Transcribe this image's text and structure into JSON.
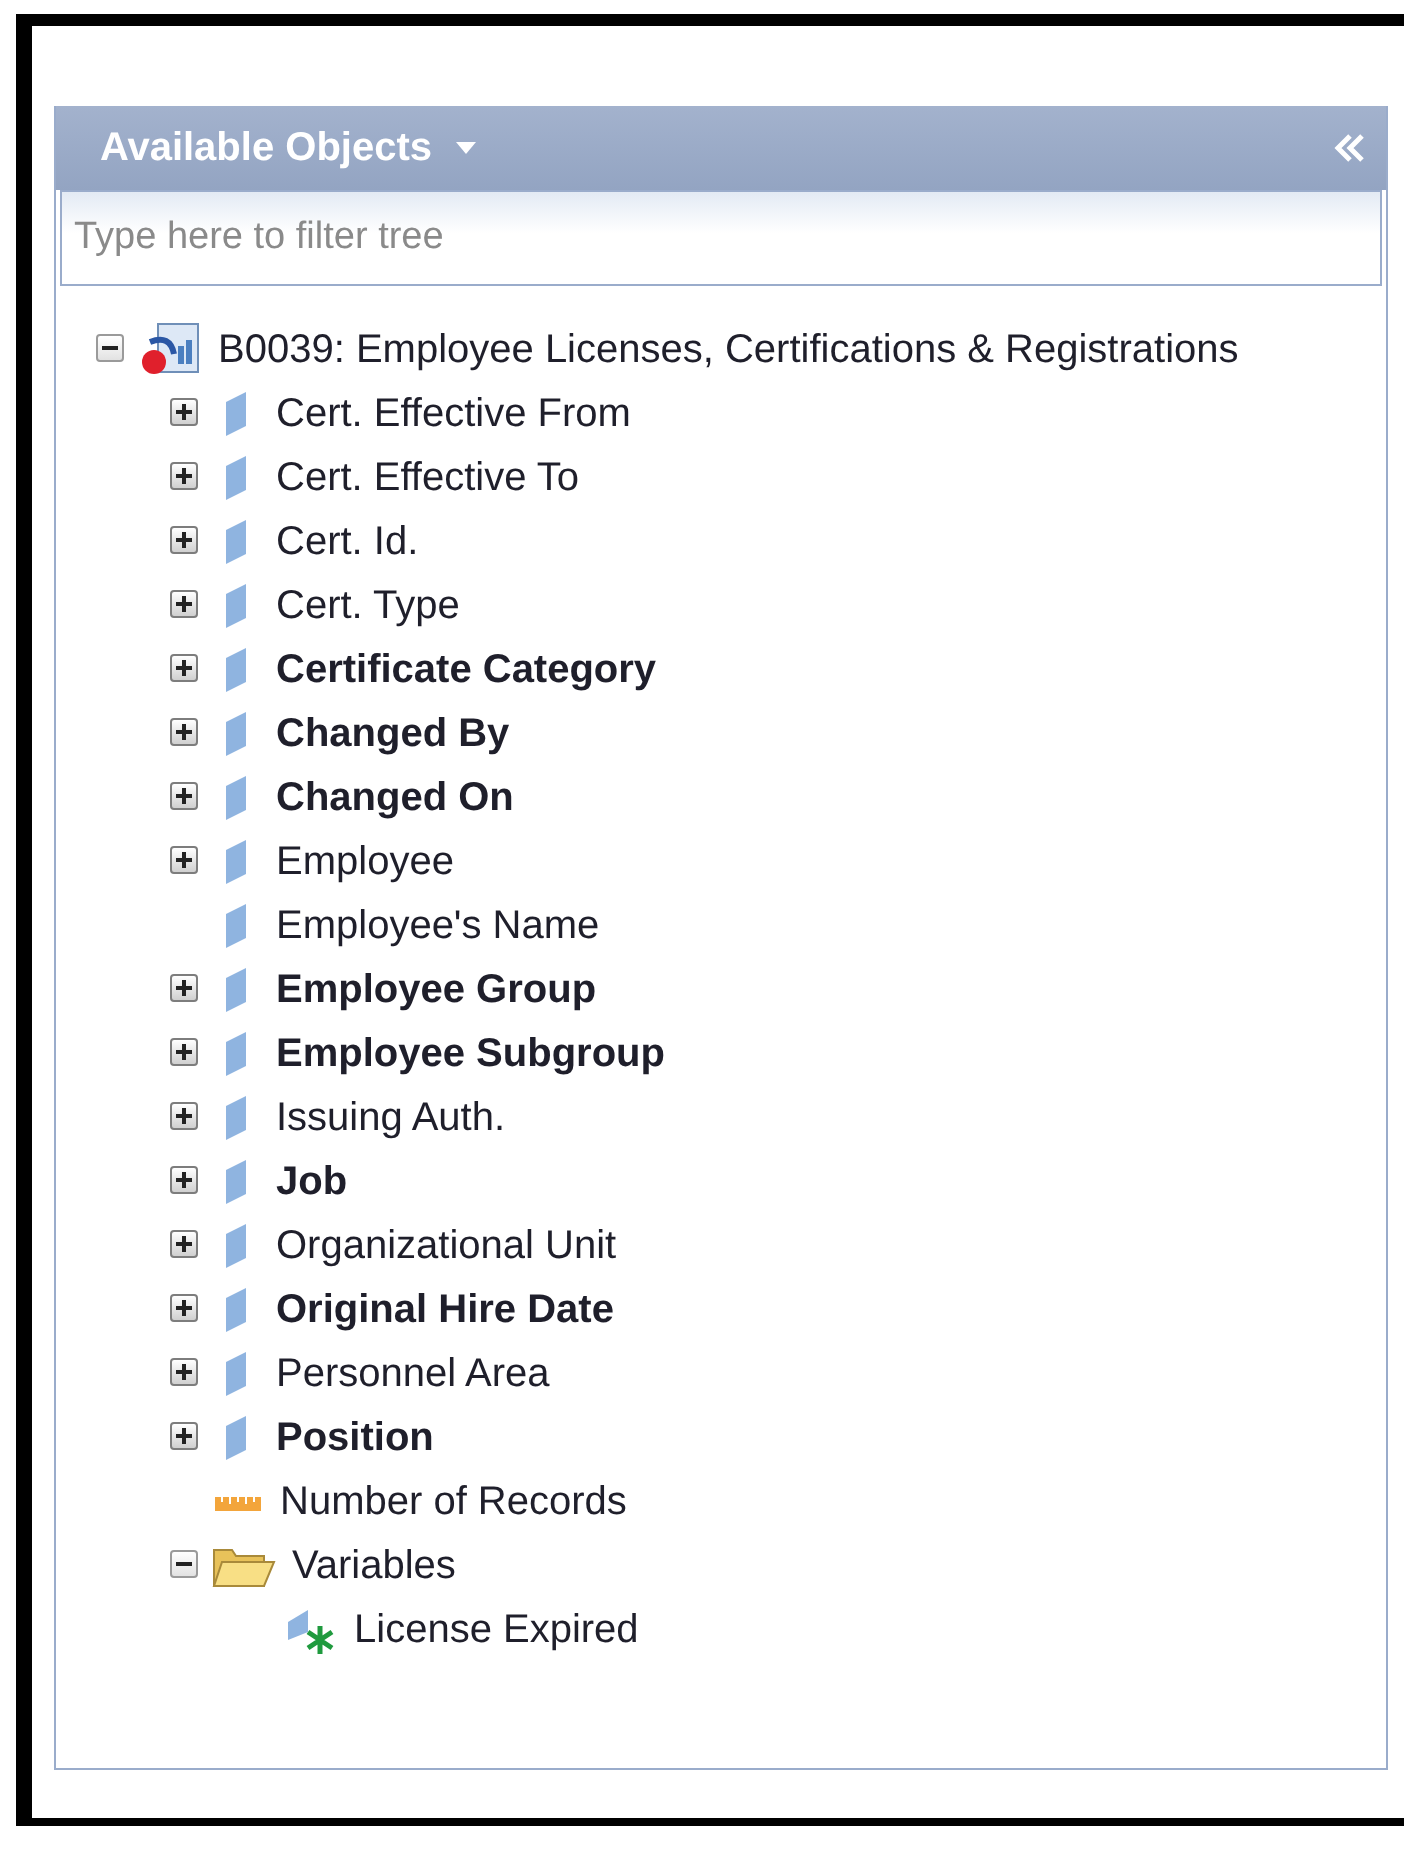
{
  "panel": {
    "title": "Available Objects",
    "filter": {
      "placeholder": "Type here to filter tree"
    },
    "tree": [
      {
        "label": "B0039: Employee Licenses, Certifications & Registrations",
        "kind": "universe",
        "bold": false,
        "expanded": true,
        "children": [
          {
            "label": "Cert. Effective From",
            "kind": "dimension",
            "bold": false,
            "expanded": false
          },
          {
            "label": "Cert. Effective To",
            "kind": "dimension",
            "bold": false,
            "expanded": false
          },
          {
            "label": "Cert. Id.",
            "kind": "dimension",
            "bold": false,
            "expanded": false
          },
          {
            "label": "Cert. Type",
            "kind": "dimension",
            "bold": false,
            "expanded": false
          },
          {
            "label": "Certificate Category",
            "kind": "dimension",
            "bold": true,
            "expanded": false
          },
          {
            "label": "Changed By",
            "kind": "dimension",
            "bold": true,
            "expanded": false
          },
          {
            "label": "Changed On",
            "kind": "dimension",
            "bold": true,
            "expanded": false
          },
          {
            "label": "Employee",
            "kind": "dimension",
            "bold": false,
            "expanded": false
          },
          {
            "label": "Employee's Name",
            "kind": "dimension",
            "bold": false
          },
          {
            "label": "Employee Group",
            "kind": "dimension",
            "bold": true,
            "expanded": false
          },
          {
            "label": "Employee Subgroup",
            "kind": "dimension",
            "bold": true,
            "expanded": false
          },
          {
            "label": "Issuing Auth.",
            "kind": "dimension",
            "bold": false,
            "expanded": false
          },
          {
            "label": "Job",
            "kind": "dimension",
            "bold": true,
            "expanded": false
          },
          {
            "label": "Organizational Unit",
            "kind": "dimension",
            "bold": false,
            "expanded": false
          },
          {
            "label": "Original Hire Date",
            "kind": "dimension",
            "bold": true,
            "expanded": false
          },
          {
            "label": "Personnel Area",
            "kind": "dimension",
            "bold": false,
            "expanded": false
          },
          {
            "label": "Position",
            "kind": "dimension",
            "bold": true,
            "expanded": false
          },
          {
            "label": "Number of Records",
            "kind": "measure",
            "bold": false
          },
          {
            "label": "Variables",
            "kind": "folder",
            "bold": false,
            "expanded": true,
            "children": [
              {
                "label": "License Expired",
                "kind": "variable",
                "bold": false
              }
            ]
          }
        ]
      }
    ]
  }
}
